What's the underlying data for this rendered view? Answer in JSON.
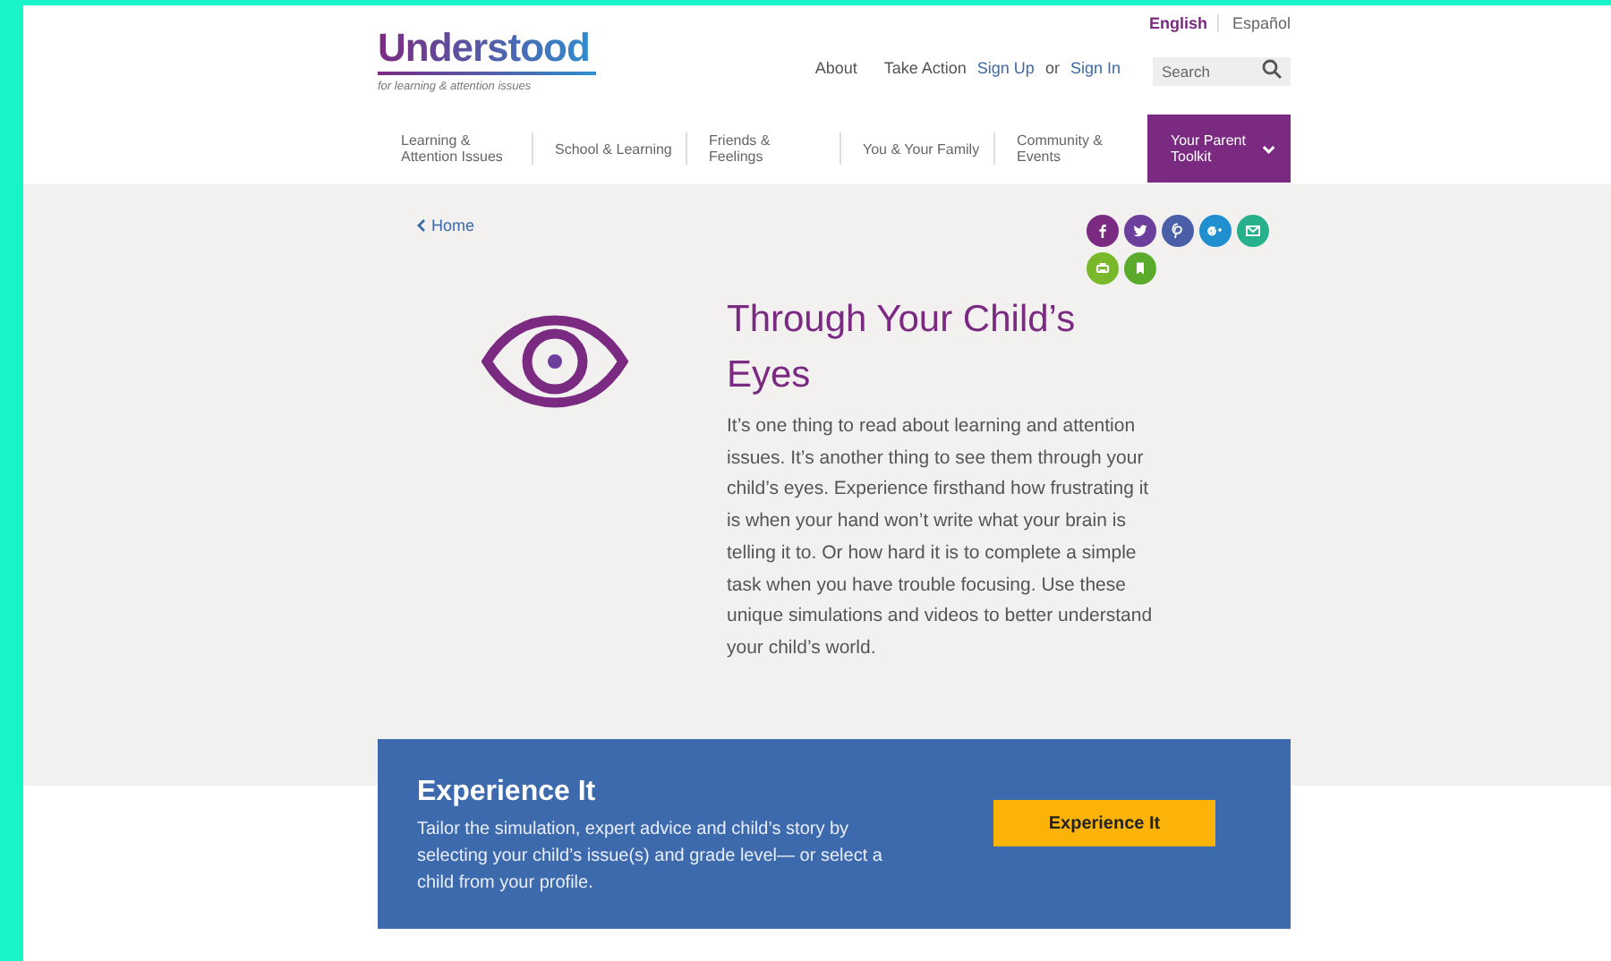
{
  "languages": [
    {
      "label": "English",
      "selected": true
    },
    {
      "label": "Español",
      "selected": false
    }
  ],
  "logo": {
    "name": "Understood",
    "tagline": "for learning & attention issues"
  },
  "top_links": [
    {
      "label": "About",
      "kind": "plain"
    },
    {
      "label": "Take Action",
      "kind": "plain"
    },
    {
      "label": "Sign Up",
      "kind": "account"
    },
    {
      "label": "or",
      "kind": "text"
    },
    {
      "label": "Sign In",
      "kind": "account"
    }
  ],
  "search": {
    "placeholder": "Search"
  },
  "nav": [
    {
      "label": "Learning & Attention Issues",
      "selected": false
    },
    {
      "label": "School & Learning",
      "selected": false
    },
    {
      "label": "Friends & Feelings",
      "selected": false
    },
    {
      "label": "You & Your Family",
      "selected": false
    },
    {
      "label": "Community & Events",
      "selected": false
    },
    {
      "label": "Your Parent Toolkit",
      "selected": true
    }
  ],
  "breadcrumb": {
    "label": "Home"
  },
  "share": [
    {
      "kind": "facebook",
      "color": "#7b2a82"
    },
    {
      "kind": "twitter",
      "color": "#6b3f9b"
    },
    {
      "kind": "pinterest",
      "color": "#4b5fa9"
    },
    {
      "kind": "googleplus",
      "color": "#1f8fcf"
    },
    {
      "kind": "email",
      "color": "#27b08c"
    },
    {
      "kind": "print",
      "color": "#79b82a"
    },
    {
      "kind": "bookmark",
      "color": "#5aaa2c"
    }
  ],
  "article": {
    "title": "Through Your Child’s Eyes",
    "body": "It’s one thing to read about learning and attention issues. It’s another thing to see them through your child’s eyes. Experience firsthand how frustrating it is when your hand won’t write what your brain is telling it to. Or how hard it is to complete a simple task when you have trouble focusing. Use these unique simulations and videos to better understand your child’s world."
  },
  "cta": {
    "title": "Experience It",
    "text": "Tailor the simulation, expert advice and child’s story by selecting your child’s issue(s) and grade level— or select a child from your profile.",
    "button": "Experience It"
  }
}
